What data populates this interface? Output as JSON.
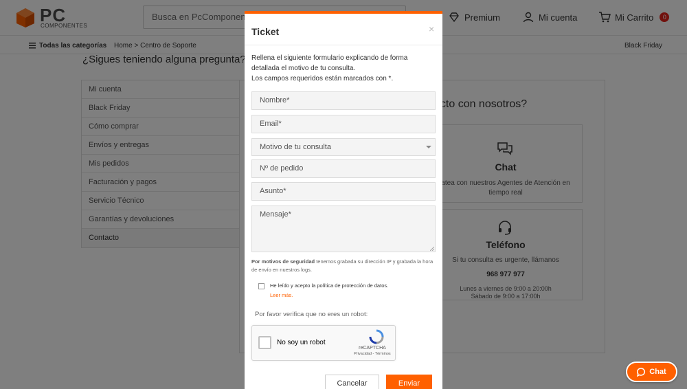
{
  "header": {
    "logo_main": "PC",
    "logo_sub": "COMPONENTES",
    "search_placeholder": "Busca en PcComponentes...",
    "premium": "Premium",
    "account": "Mi cuenta",
    "cart": "Mi Carrito",
    "cart_count": "0"
  },
  "subheader": {
    "all_categories": "Todas las categorías",
    "breadcrumb": "Home > Centro de Soporte",
    "black_friday": "Black Friday"
  },
  "page": {
    "question": "¿Sigues teniendo alguna pregunta?",
    "menu": [
      "Mi cuenta",
      "Black Friday",
      "Cómo comprar",
      "Envíos y entregas",
      "Mis pedidos",
      "Facturación y pagos",
      "Servicio Técnico",
      "Garantías y devoluciones",
      "Contacto"
    ],
    "contact_title": "acto con nosotros?",
    "chat_card": {
      "title": "Chat",
      "text": "atea con nuestros Agentes de Atención en tiempo real"
    },
    "phone_card": {
      "title": "Teléfono",
      "text": "Si tu consulta es urgente, llámanos",
      "number": "968 977 977",
      "hours1": "Lunes a viernes de 9:00 a 20:00h",
      "hours2": "Sábado de 9:00 a 17:00h"
    }
  },
  "modal": {
    "title": "Ticket",
    "close": "×",
    "desc_line1": "Rellena el siguiente formulario explicando de forma detallada el motivo de tu consulta.",
    "desc_line2": "Los campos requeridos están marcados con *.",
    "fields": {
      "name": "Nombre*",
      "email": "Email*",
      "reason": "Motivo de tu consulta",
      "order": "Nº de pedido",
      "subject": "Asunto*",
      "message": "Mensaje*"
    },
    "security_bold": "Por motivos de seguridad",
    "security_rest": " tenemos grabada su dirección IP y grabada la hora de envío en nuestros logs.",
    "privacy": "He leído y acepto la política de protección de datos.",
    "read_more": "Leer más.",
    "robot_prompt": "Por favor verifica que no eres un robot:",
    "recaptcha": {
      "label": "No soy un robot",
      "brand": "reCAPTCHA",
      "links": "Privacidad - Términos"
    },
    "cancel": "Cancelar",
    "send": "Enviar"
  },
  "chat_fab": "Chat",
  "colors": {
    "accent": "#ff6000",
    "badge": "#e2231a"
  }
}
